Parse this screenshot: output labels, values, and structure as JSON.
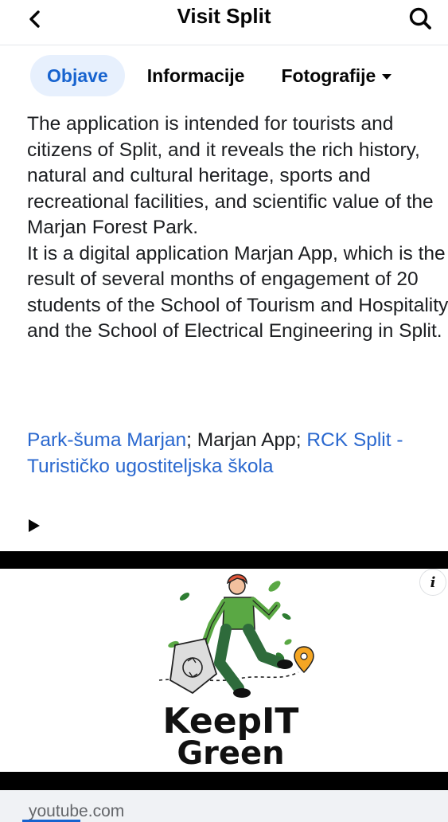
{
  "header": {
    "title": "Visit Split",
    "back_icon": "chevron-left-icon",
    "search_icon": "search-icon"
  },
  "tabs": [
    {
      "label": "Objave",
      "active": true
    },
    {
      "label": "Informacije",
      "active": false
    },
    {
      "label": "Fotografije",
      "active": false,
      "has_dropdown": true
    }
  ],
  "post": {
    "paragraph_1": "The application is intended for tourists and citizens of Split, and it reveals the rich history, natural and cultural heritage, sports and recreational facilities, and scientific value of the Marjan Forest Park.",
    "paragraph_2": "It is a digital application Marjan App, which is the result of several months of engagement of 20 students of the School of Tourism and Hospitality, and the School of Electrical Engineering in Split.",
    "tags": {
      "tag_1": "Park-šuma Marjan",
      "separator_1": "; Marjan App; ",
      "tag_2": "RCK Split - Turističko ugostiteljska škola"
    }
  },
  "video": {
    "logo_line_1": "KeepIT",
    "logo_line_2": "Green",
    "info_label": "i",
    "source": "youtube.com",
    "progress_fraction": 0.13
  },
  "colors": {
    "accent": "#1763cf",
    "tab_active_bg": "#e7f0fd",
    "link": "#2a68cf",
    "logo_green": "#2e7d32",
    "person_shirt": "#5aa844",
    "person_hair": "#e2563a",
    "pin_orange": "#f5a623"
  }
}
